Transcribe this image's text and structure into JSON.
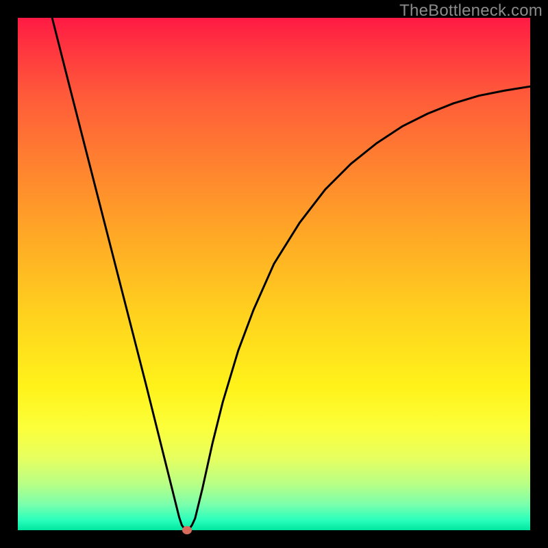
{
  "watermark": "TheBottleneck.com",
  "chart_data": {
    "type": "line",
    "title": "",
    "xlabel": "",
    "ylabel": "",
    "xlim": [
      0,
      100
    ],
    "ylim": [
      0,
      100
    ],
    "grid": false,
    "series": [
      {
        "name": "curve",
        "x": [
          6.7,
          10,
          15,
          20,
          25,
          28,
          30,
          31,
          31.5,
          32,
          32.5,
          33,
          33.5,
          34,
          34.6,
          36,
          38,
          40,
          43,
          46,
          50,
          55,
          60,
          65,
          70,
          75,
          80,
          85,
          90,
          95,
          100
        ],
        "y": [
          100,
          87,
          67.5,
          48,
          28.5,
          16.5,
          8.5,
          4.5,
          2.5,
          1,
          0.3,
          0,
          0.3,
          1,
          2.3,
          8,
          17,
          25,
          35,
          43,
          52,
          60,
          66.5,
          71.5,
          75.5,
          78.8,
          81.3,
          83.3,
          84.8,
          85.8,
          86.6
        ]
      }
    ],
    "marker": {
      "x": 33,
      "y": 0
    },
    "background_gradient": {
      "top": "#ff1a44",
      "mid": "#ffd21e",
      "bottom": "#00e6a0"
    }
  }
}
